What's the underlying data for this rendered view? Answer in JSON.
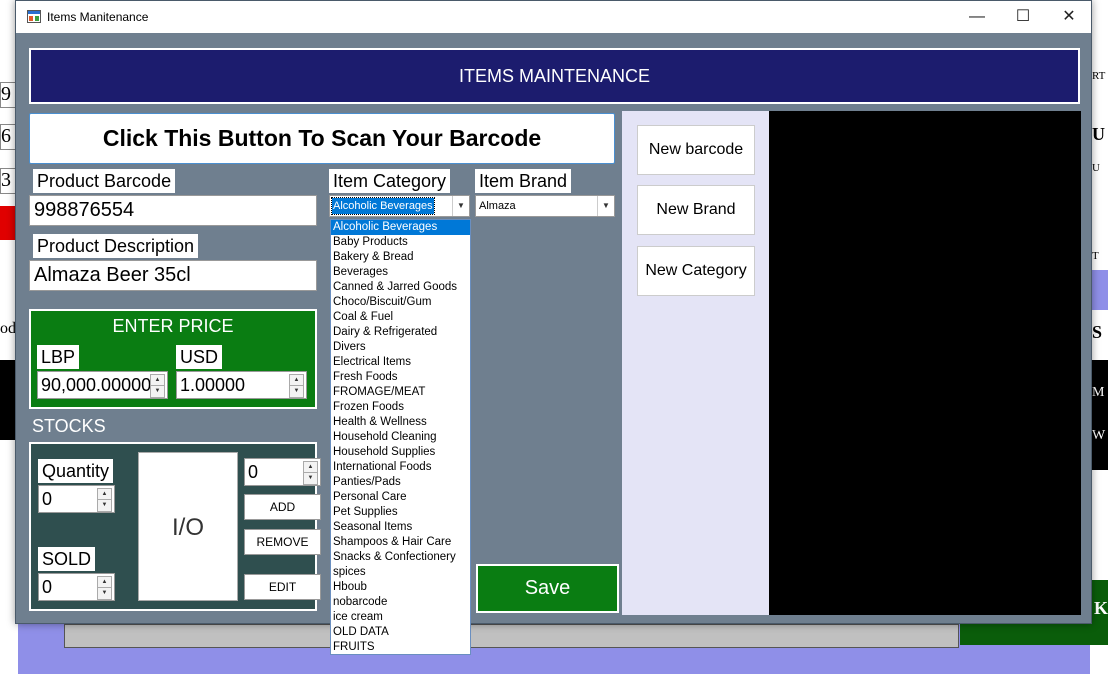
{
  "window": {
    "title": "Items Manitenance",
    "minimize": "—",
    "maximize": "☐",
    "close": "✕"
  },
  "banner": "ITEMS MAINTENANCE",
  "scan_button": "Click This Button To Scan Your Barcode",
  "product_barcode": {
    "label": "Product Barcode",
    "value": "998876554"
  },
  "product_description": {
    "label": "Product Description",
    "value": "Almaza Beer 35cl"
  },
  "item_category": {
    "label": "Item Category",
    "selected": "Alcoholic Beverages",
    "options": [
      "Alcoholic Beverages",
      "Baby Products",
      "Bakery & Bread",
      "Beverages",
      "Canned & Jarred Goods",
      "Choco/Biscuit/Gum",
      "Coal & Fuel",
      "Dairy & Refrigerated",
      "Divers",
      "Electrical Items",
      "Fresh Foods",
      "FROMAGE/MEAT",
      "Frozen Foods",
      "Health & Wellness",
      "Household Cleaning",
      "Household Supplies",
      "International Foods",
      "Panties/Pads",
      "Personal Care",
      "Pet Supplies",
      "Seasonal Items",
      "Shampoos & Hair Care",
      "Snacks & Confectionery",
      "spices",
      "Hboub",
      "nobarcode",
      "ice cream",
      "OLD DATA",
      "FRUITS"
    ]
  },
  "item_brand": {
    "label": "Item Brand",
    "selected": "Almaza"
  },
  "price": {
    "title": "ENTER PRICE",
    "lbp_label": "LBP",
    "lbp_value": "90,000.00000",
    "usd_label": "USD",
    "usd_value": "1.00000"
  },
  "stocks": {
    "title": "STOCKS",
    "quantity_label": "Quantity",
    "quantity_value": "0",
    "sold_label": "SOLD",
    "sold_value": "0",
    "io_label": "I/O",
    "adjust_value": "0",
    "add_label": "ADD",
    "remove_label": "REMOVE",
    "edit_label": "EDIT"
  },
  "save_label": "Save",
  "side_buttons": {
    "new_barcode": "New barcode",
    "new_brand": "New Brand",
    "new_category": "New Category"
  },
  "colors": {
    "banner": "#1c1c6e",
    "form_bg": "#6f7f8f",
    "green": "#0a7d12",
    "stocks_bg": "#2f4f4f",
    "selection": "#0078d7"
  },
  "background_fragments": {
    "left": [
      "9",
      "6",
      "3",
      "od"
    ],
    "right": [
      "RT",
      "U",
      "U",
      "T",
      "S",
      "M",
      "W",
      "K"
    ]
  }
}
